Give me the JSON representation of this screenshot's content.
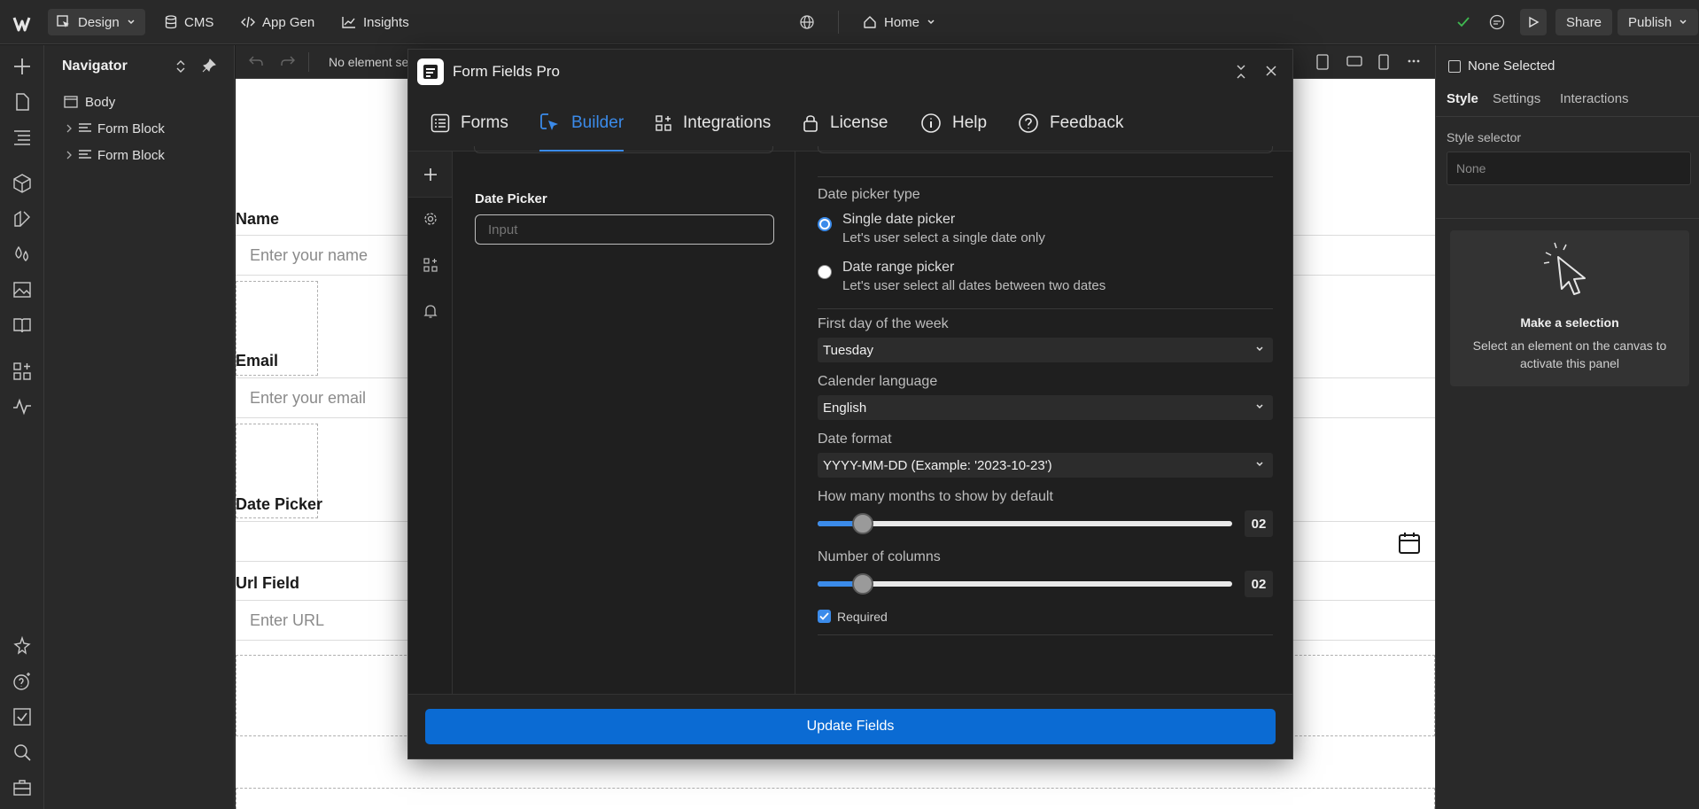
{
  "topbar": {
    "design_label": "Design",
    "cms_label": "CMS",
    "appgen_label": "App Gen",
    "insights_label": "Insights",
    "page_label": "Home",
    "share_label": "Share",
    "publish_label": "Publish"
  },
  "navigator": {
    "title": "Navigator",
    "items": [
      {
        "label": "Body"
      },
      {
        "label": "Form Block"
      },
      {
        "label": "Form Block"
      }
    ]
  },
  "canvas_toolbar": {
    "status": "No element se"
  },
  "canvas": {
    "fields": [
      {
        "label": "Name",
        "placeholder": "Enter your name"
      },
      {
        "label": "Email",
        "placeholder": "Enter your email"
      },
      {
        "label": "Date Picker",
        "placeholder": ""
      },
      {
        "label": "Url Field",
        "placeholder": "Enter URL"
      }
    ]
  },
  "modal": {
    "title": "Form Fields Pro",
    "tabs": [
      {
        "label": "Forms"
      },
      {
        "label": "Builder"
      },
      {
        "label": "Integrations"
      },
      {
        "label": "License"
      },
      {
        "label": "Help"
      },
      {
        "label": "Feedback"
      }
    ],
    "left": {
      "field_label": "Date Picker",
      "field_placeholder": "Input"
    },
    "right": {
      "picker_type_label": "Date picker type",
      "option_single_title": "Single date picker",
      "option_single_desc": "Let's user select a single date only",
      "option_range_title": "Date range picker",
      "option_range_desc": "Let's user select all dates between two dates",
      "first_day_label": "First day of the week",
      "first_day_value": "Tuesday",
      "language_label": "Calender language",
      "language_value": "English",
      "format_label": "Date format",
      "format_value": "YYYY-MM-DD (Example: '2023-10-23')",
      "months_label": "How many months to show by default",
      "months_value": "02",
      "months_fraction": 0.11,
      "columns_label": "Number of columns",
      "columns_value": "02",
      "columns_fraction": 0.11,
      "required_label": "Required",
      "required_checked": true
    },
    "update_label": "Update Fields"
  },
  "rightpanel": {
    "selection_label": "None Selected",
    "tabs": [
      {
        "label": "Style"
      },
      {
        "label": "Settings"
      },
      {
        "label": "Interactions"
      }
    ],
    "style_selector_label": "Style selector",
    "style_selector_value": "None",
    "make_selection_title": "Make a selection",
    "make_selection_desc": "Select an element on the canvas to activate this panel"
  },
  "colors": {
    "accent": "#3b8bea",
    "button": "#0b6bd3",
    "check_green": "#3fb950"
  }
}
